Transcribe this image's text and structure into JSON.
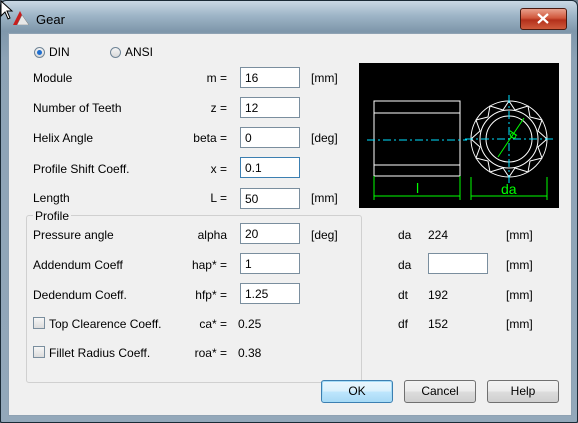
{
  "window": {
    "title": "Gear"
  },
  "standard": {
    "din_label": "DIN",
    "ansi_label": "ANSI",
    "selected": "DIN"
  },
  "fields": {
    "module": {
      "label": "Module",
      "symbol": "m =",
      "value": "16",
      "unit": "[mm]"
    },
    "teeth": {
      "label": "Number of Teeth",
      "symbol": "z =",
      "value": "12",
      "unit": ""
    },
    "helix": {
      "label": "Helix Angle",
      "symbol": "beta =",
      "value": "0",
      "unit": "[deg]"
    },
    "shift": {
      "label": "Profile Shift Coeff.",
      "symbol": "x =",
      "value": "0.1",
      "unit": ""
    },
    "length": {
      "label": "Length",
      "symbol": "L =",
      "value": "50",
      "unit": "[mm]"
    }
  },
  "profile": {
    "title": "Profile",
    "pressure": {
      "label": "Pressure angle",
      "symbol": "alpha",
      "value": "20",
      "unit": "[deg]"
    },
    "addendum": {
      "label": "Addendum Coeff",
      "symbol": "hap* =",
      "value": "1"
    },
    "dedendum": {
      "label": "Dedendum Coeff.",
      "symbol": "hfp* =",
      "value": "1.25"
    },
    "top_clearance": {
      "label": "Top Clearence Coeff.",
      "symbol": "ca* =",
      "value": "0.25",
      "checked": false
    },
    "fillet": {
      "label": "Fillet Radius Coeff.",
      "symbol": "roa* =",
      "value": "0.38",
      "checked": false
    }
  },
  "results": [
    {
      "name": "da",
      "value": "224",
      "unit": "[mm]",
      "editable": false
    },
    {
      "name": "da",
      "value": "",
      "unit": "[mm]",
      "editable": true
    },
    {
      "name": "dt",
      "value": "192",
      "unit": "[mm]",
      "editable": false
    },
    {
      "name": "df",
      "value": "152",
      "unit": "[mm]",
      "editable": false
    }
  ],
  "preview": {
    "label_length": "l",
    "label_diameter": "da",
    "label_pitch": "d"
  },
  "buttons": {
    "ok": "OK",
    "cancel": "Cancel",
    "help": "Help"
  },
  "colors": {
    "preview_bg": "#000000",
    "preview_lines": "#ffffff",
    "preview_dims": "#00ff00",
    "preview_centerline": "#00e0ff",
    "accent": "#1f6fd0"
  }
}
